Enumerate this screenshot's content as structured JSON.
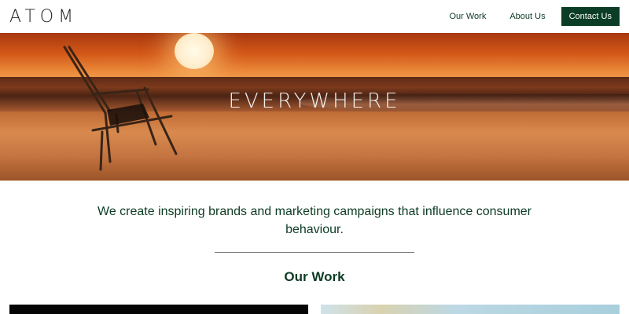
{
  "brand": {
    "logo_text": "ATOM"
  },
  "nav": {
    "items": [
      {
        "label": "Our Work"
      },
      {
        "label": "About Us"
      }
    ],
    "cta_label": "Contact Us",
    "cta_color": "#0b3d26"
  },
  "hero": {
    "title": "EVERYWHERE",
    "image": "sunset-beach-chair"
  },
  "intro": {
    "text": "We create inspiring brands and marketing campaigns that influence consumer behaviour."
  },
  "work_section": {
    "title": "Our Work",
    "thumbnails": [
      {
        "image": "dark-project-thumbnail"
      },
      {
        "image": "sky-project-thumbnail"
      }
    ]
  },
  "colors": {
    "brand_green": "#0d3b24",
    "background": "#ffffff"
  }
}
